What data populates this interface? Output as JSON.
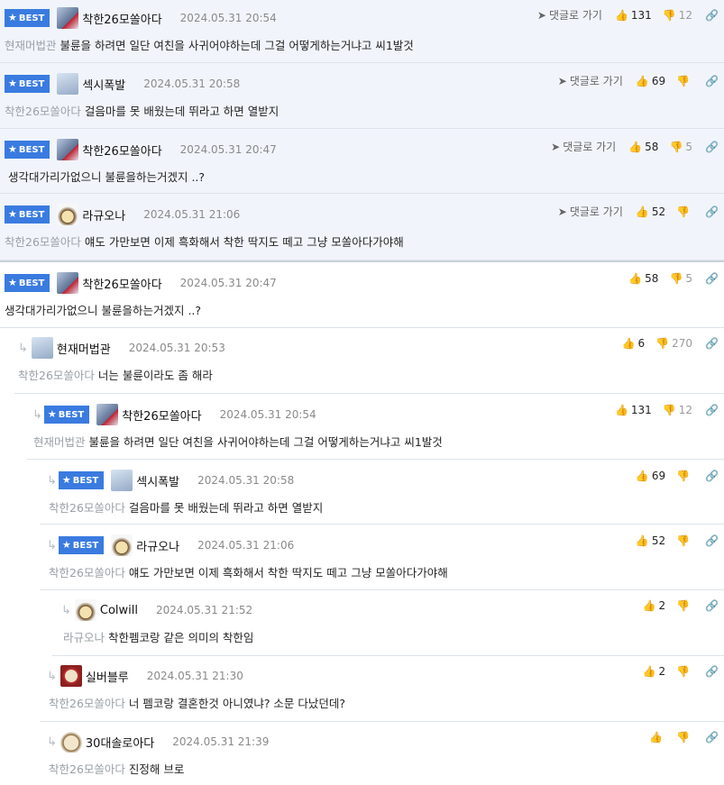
{
  "labels": {
    "best": "BEST",
    "goto": "댓글로 가기"
  },
  "best_comments": [
    {
      "nick": "착한26모쏠아다",
      "date": "2024.05.31 20:54",
      "mention": "현재머법관",
      "text": "불륜을 하려면 일단 여친을 사귀어야하는데 그걸 어떻게하는거냐고 씨1발것",
      "up": "131",
      "down": "12"
    },
    {
      "nick": "섹시폭발",
      "date": "2024.05.31 20:58",
      "mention": "착한26모쏠아다",
      "text": "걸음마를 못 배웠는데 뛰라고 하면 열받지",
      "up": "69",
      "down": ""
    },
    {
      "nick": "착한26모쏠아다",
      "date": "2024.05.31 20:47",
      "mention": "",
      "text": "생각대가리가없으니 불륜을하는거겠지 ..?",
      "up": "58",
      "down": "5"
    },
    {
      "nick": "라규오나",
      "date": "2024.05.31 21:06",
      "mention": "착한26모쏠아다",
      "text": "얘도 가만보면 이제 흑화해서 착한 딱지도 떼고 그냥 모쏠아다가야해",
      "up": "52",
      "down": ""
    }
  ],
  "thread": [
    {
      "nick": "착한26모쏠아다",
      "date": "2024.05.31 20:47",
      "mention": "",
      "best": true,
      "text": "생각대가리가없으니 불륜을하는거겠지 ..?",
      "up": "58",
      "down": "5"
    },
    {
      "nick": "현재머법관",
      "date": "2024.05.31 20:53",
      "mention": "착한26모쏠아다",
      "best": false,
      "text": "너는 불륜이라도 좀 해라",
      "up": "6",
      "down": "270"
    },
    {
      "nick": "착한26모쏠아다",
      "date": "2024.05.31 20:54",
      "mention": "현재머법관",
      "best": true,
      "text": "불륜을 하려면 일단 여친을 사귀어야하는데 그걸 어떻게하는거냐고 씨1발것",
      "up": "131",
      "down": "12"
    },
    {
      "nick": "섹시폭발",
      "date": "2024.05.31 20:58",
      "mention": "착한26모쏠아다",
      "best": true,
      "text": "걸음마를 못 배웠는데 뛰라고 하면 열받지",
      "up": "69",
      "down": ""
    },
    {
      "nick": "라규오나",
      "date": "2024.05.31 21:06",
      "mention": "착한26모쏠아다",
      "best": true,
      "text": "얘도 가만보면 이제 흑화해서 착한 딱지도 떼고 그냥 모쏠아다가야해",
      "up": "52",
      "down": ""
    },
    {
      "nick": "Colwill",
      "date": "2024.05.31 21:52",
      "mention": "라규오나",
      "best": false,
      "text": "착한펨코랑 같은 의미의 착한임",
      "up": "2",
      "down": ""
    },
    {
      "nick": "실버블루",
      "date": "2024.05.31 21:30",
      "mention": "착한26모쏠아다",
      "best": false,
      "text": "너 펨코랑 결혼한것 아니였냐? 소문 다났던데?",
      "up": "2",
      "down": ""
    },
    {
      "nick": "30대솔로아다",
      "date": "2024.05.31 21:39",
      "mention": "착한26모쏠아다",
      "best": false,
      "text": "진정해 브로",
      "up": "",
      "down": ""
    }
  ]
}
